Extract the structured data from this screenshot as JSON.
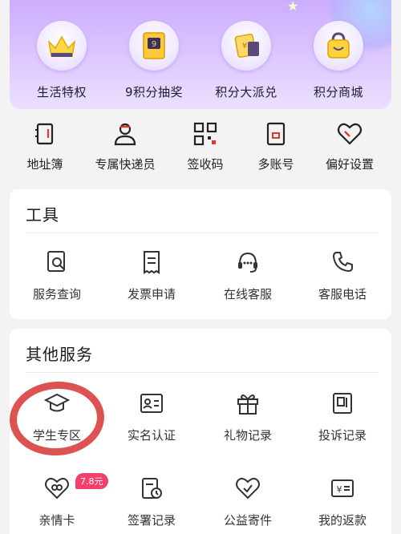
{
  "banner": {
    "items": [
      {
        "label": "生活特权",
        "icon": "crown-icon"
      },
      {
        "label": "9积分抽奖",
        "icon": "lottery-ticket-icon"
      },
      {
        "label": "积分大派兑",
        "icon": "coupon-icon"
      },
      {
        "label": "积分商城",
        "icon": "shopping-bag-icon"
      }
    ]
  },
  "quick": {
    "items": [
      {
        "label": "地址簿",
        "icon": "address-book-icon"
      },
      {
        "label": "专属快递员",
        "icon": "courier-icon"
      },
      {
        "label": "签收码",
        "icon": "qr-code-icon"
      },
      {
        "label": "多账号",
        "icon": "multi-account-icon"
      },
      {
        "label": "偏好设置",
        "icon": "heart-icon"
      }
    ]
  },
  "tools": {
    "title": "工具",
    "items": [
      {
        "label": "服务查询",
        "icon": "service-query-icon"
      },
      {
        "label": "发票申请",
        "icon": "invoice-icon"
      },
      {
        "label": "在线客服",
        "icon": "headset-icon"
      },
      {
        "label": "客服电话",
        "icon": "phone-icon"
      }
    ]
  },
  "other": {
    "title": "其他服务",
    "items": [
      {
        "label": "学生专区",
        "icon": "graduation-cap-icon"
      },
      {
        "label": "实名认证",
        "icon": "id-card-icon"
      },
      {
        "label": "礼物记录",
        "icon": "gift-icon"
      },
      {
        "label": "投诉记录",
        "icon": "complaint-icon"
      },
      {
        "label": "亲情卡",
        "icon": "family-card-icon"
      },
      {
        "label": "签署记录",
        "icon": "sign-record-icon"
      },
      {
        "label": "公益寄件",
        "icon": "charity-heart-icon"
      },
      {
        "label": "我的返款",
        "icon": "refund-icon"
      }
    ],
    "family_card_badge": "7.8元"
  },
  "colors": {
    "accent_red": "#d9403f",
    "badge_pink": "#f2406a",
    "banner_purple": "#c9a8ff"
  }
}
